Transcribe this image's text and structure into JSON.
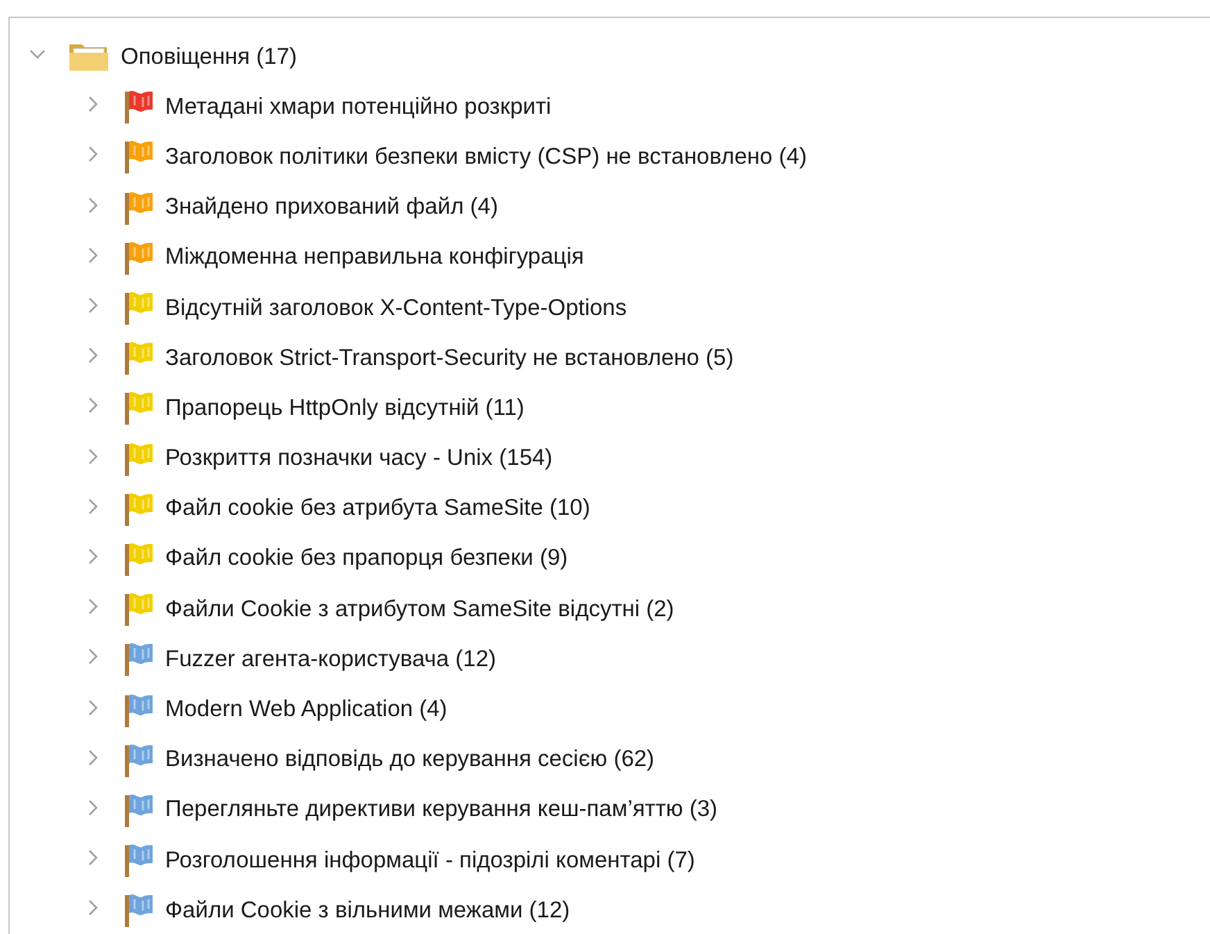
{
  "tree": {
    "label": "Оповіщення (17)",
    "expanded": true,
    "children": [
      {
        "label": "Метадані хмари потенційно розкриті",
        "color": "#e8392c",
        "expanded": false
      },
      {
        "label": "Заголовок політики безпеки вмісту (CSP) не встановлено (4)",
        "color": "#f7a10c",
        "expanded": false
      },
      {
        "label": "Знайдено прихований файл (4)",
        "color": "#f7a10c",
        "expanded": false
      },
      {
        "label": "Міждоменна неправильна конфігурація",
        "color": "#f7a10c",
        "expanded": false
      },
      {
        "label": "Відсутній заголовок X-Content-Type-Options",
        "color": "#f2d000",
        "expanded": false
      },
      {
        "label": "Заголовок Strict-Transport-Security не встановлено (5)",
        "color": "#f2d000",
        "expanded": false
      },
      {
        "label": "Прапорець HttpOnly відсутній (11)",
        "color": "#f2d000",
        "expanded": false
      },
      {
        "label": "Розкриття позначки часу - Unix (154)",
        "color": "#f2d000",
        "expanded": false
      },
      {
        "label": "Файл cookie без атрибута SameSite (10)",
        "color": "#f2d000",
        "expanded": false
      },
      {
        "label": "Файл cookie без прапорця безпеки (9)",
        "color": "#f2d000",
        "expanded": false
      },
      {
        "label": "Файли Cookie з атрибутом SameSite відсутні (2)",
        "color": "#f2d000",
        "expanded": false
      },
      {
        "label": "Fuzzer агента-користувача (12)",
        "color": "#6fa4dc",
        "expanded": false
      },
      {
        "label": "Modern Web Application (4)",
        "color": "#6fa4dc",
        "expanded": false
      },
      {
        "label": "Визначено відповідь до керування сесією (62)",
        "color": "#6fa4dc",
        "expanded": false
      },
      {
        "label": "Перегляньте директиви керування кеш-пам’яттю (3)",
        "color": "#6fa4dc",
        "expanded": false
      },
      {
        "label": "Розголошення інформації - підозрілі коментарі (7)",
        "color": "#6fa4dc",
        "expanded": false
      },
      {
        "label": "Файли Cookie з вільними межами (12)",
        "color": "#6fa4dc",
        "expanded": false
      }
    ]
  }
}
